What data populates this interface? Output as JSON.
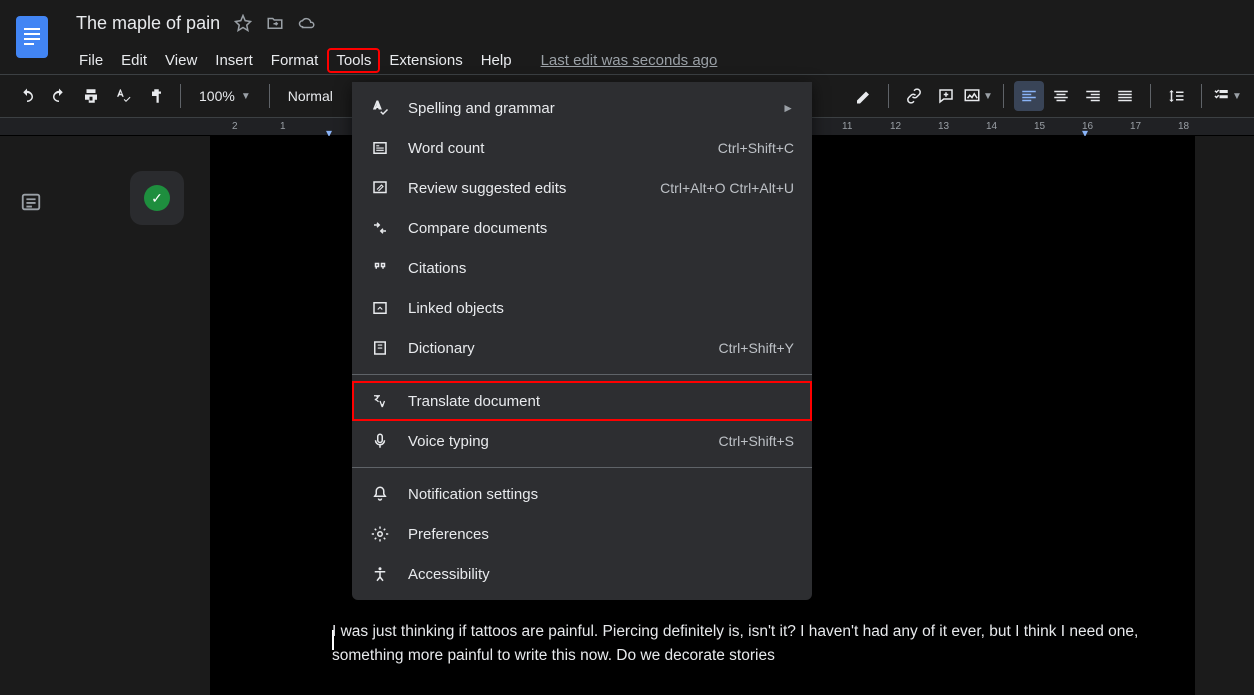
{
  "header": {
    "title": "The maple of pain",
    "last_edit": "Last edit was seconds ago"
  },
  "menu": {
    "file": "File",
    "edit": "Edit",
    "view": "View",
    "insert": "Insert",
    "format": "Format",
    "tools": "Tools",
    "extensions": "Extensions",
    "help": "Help"
  },
  "toolbar": {
    "zoom": "100%",
    "style": "Normal"
  },
  "tools_menu": {
    "spelling": "Spelling and grammar",
    "word_count": "Word count",
    "word_count_shortcut": "Ctrl+Shift+C",
    "review": "Review suggested edits",
    "review_shortcut": "Ctrl+Alt+O Ctrl+Alt+U",
    "compare": "Compare documents",
    "citations": "Citations",
    "linked": "Linked objects",
    "dictionary": "Dictionary",
    "dictionary_shortcut": "Ctrl+Shift+Y",
    "translate": "Translate document",
    "voice": "Voice typing",
    "voice_shortcut": "Ctrl+Shift+S",
    "notifications": "Notification settings",
    "preferences": "Preferences",
    "accessibility": "Accessibility"
  },
  "ruler": {
    "ticks_left": [
      "2",
      "1"
    ],
    "ticks_right": [
      "11",
      "12",
      "13",
      "14",
      "15",
      "16",
      "17",
      "18"
    ]
  },
  "document": {
    "body_text": "I was just thinking if tattoos are painful. Piercing definitely is, isn't it? I haven't had any of it ever, but I think I need one, something more painful to write this now. Do we decorate stories"
  }
}
